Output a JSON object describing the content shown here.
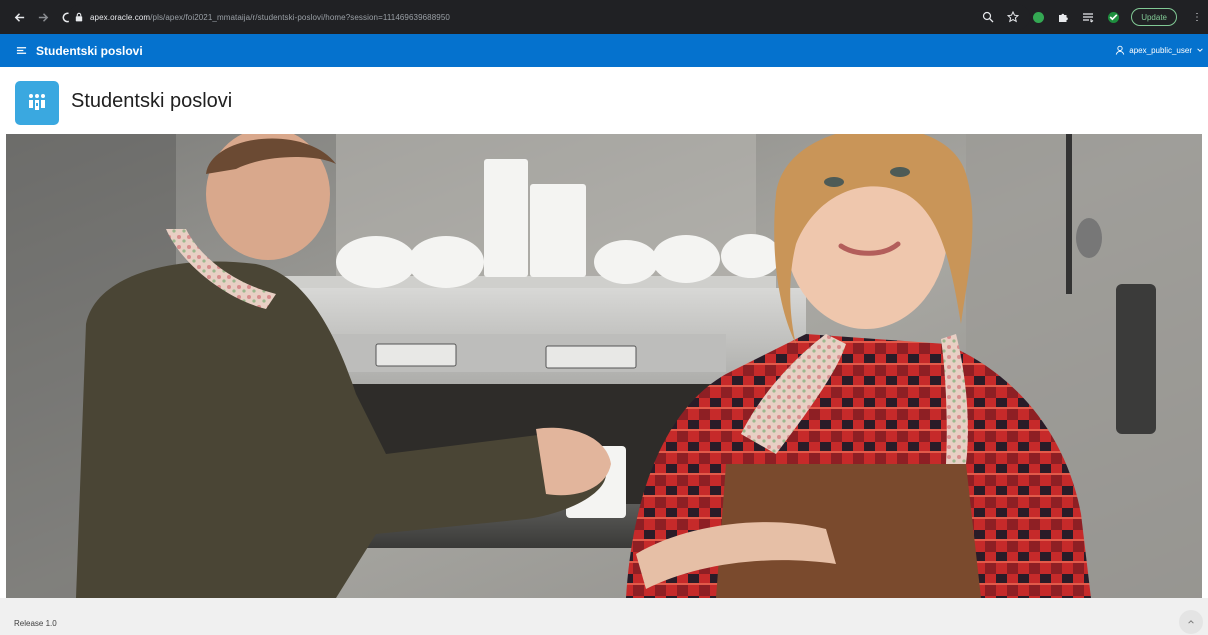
{
  "browser": {
    "url_host": "apex.oracle.com",
    "url_path": "/pls/apex/foi2021_mmataija/r/studentski-poslovi/home?session=111469639688950",
    "update_label": "Update",
    "icons": [
      "back-arrow-icon",
      "forward-arrow-icon",
      "reload-icon",
      "lock-icon",
      "zoom-icon",
      "star-icon",
      "extension-icon",
      "puzzle-icon",
      "reading-list-icon",
      "check-extension-icon",
      "more-icon"
    ]
  },
  "header": {
    "app_title": "Studentski poslovi",
    "user_name": "apex_public_user",
    "icons": [
      "hamburger-menu-icon",
      "user-icon",
      "chevron-down-icon"
    ],
    "color": "#0572ce"
  },
  "page": {
    "title": "Studentski poslovi",
    "badge_color": "#3aa8e0",
    "badge_icon": "people-icon"
  },
  "footer": {
    "release": "Release 1.0",
    "scroll_icon": "chevron-up-icon"
  }
}
